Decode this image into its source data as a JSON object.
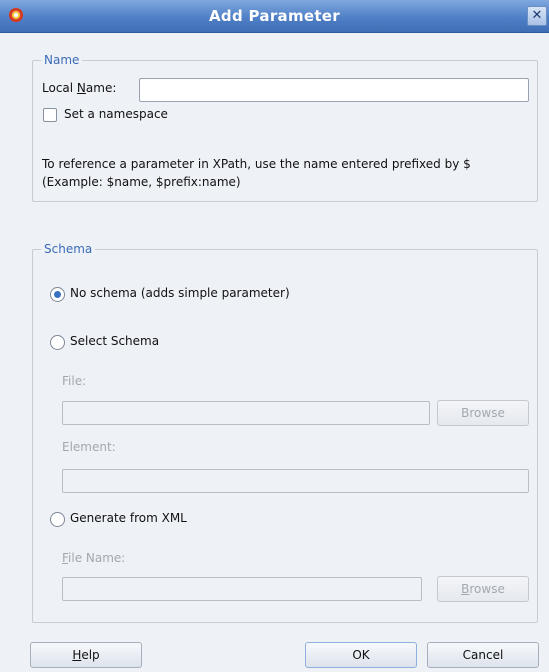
{
  "window": {
    "title": "Add Parameter",
    "close_glyph": "✕",
    "logo_icon": "oracle-logo-icon"
  },
  "name_group": {
    "legend": "Name",
    "local_name_label_pre": "Local ",
    "local_name_label_mnemonic": "N",
    "local_name_label_post": "ame:",
    "local_name_value": "",
    "set_namespace_label": "Set a namespace",
    "set_namespace_checked": false,
    "help_line1": "To reference a parameter in XPath, use the name entered prefixed by $",
    "help_line2": "(Example: $name, $prefix:name)"
  },
  "schema_group": {
    "legend": "Schema",
    "no_schema_label": "No schema (adds simple parameter)",
    "select_schema_label": "Select Schema",
    "file_label": "File:",
    "file_value": "",
    "browse_label": "Browse",
    "element_label": "Element:",
    "element_value": "",
    "generate_label": "Generate from XML",
    "file_name_label_mnemonic": "F",
    "file_name_label_rest": "ile Name:",
    "file_name_value": "",
    "browse2_mnemonic": "B",
    "browse2_rest": "rowse",
    "selected_option": "no_schema"
  },
  "buttons": {
    "help_mnemonic": "H",
    "help_rest": "elp",
    "ok": "OK",
    "cancel": "Cancel"
  }
}
